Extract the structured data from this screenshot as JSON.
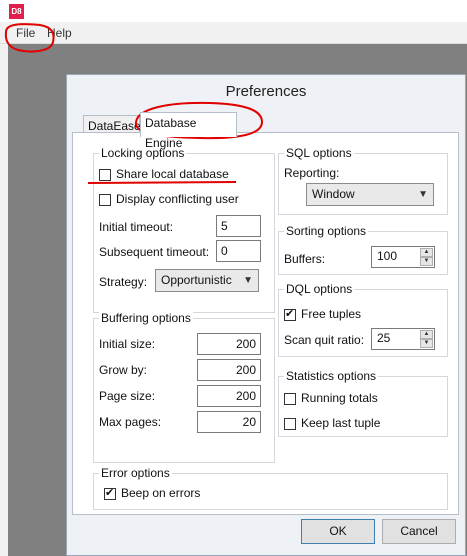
{
  "app": {
    "icon_text": "D8"
  },
  "menu": {
    "file": "File",
    "help": "Help"
  },
  "dialog": {
    "title": "Preferences",
    "tabs": [
      "DataEase",
      "Database Engine"
    ],
    "locking": {
      "title": "Locking options",
      "share_local_db": {
        "label": "Share local database",
        "checked": false
      },
      "display_conflicting": {
        "label": "Display conflicting user",
        "checked": false
      },
      "initial_timeout": {
        "label": "Initial timeout:",
        "value": "5"
      },
      "subsequent_timeout": {
        "label": "Subsequent timeout:",
        "value": "0"
      },
      "strategy": {
        "label": "Strategy:",
        "value": "Opportunistic"
      }
    },
    "buffering": {
      "title": "Buffering options",
      "initial_size": {
        "label": "Initial size:",
        "value": "200"
      },
      "grow_by": {
        "label": "Grow by:",
        "value": "200"
      },
      "page_size": {
        "label": "Page size:",
        "value": "200"
      },
      "max_pages": {
        "label": "Max pages:",
        "value": "20"
      }
    },
    "error": {
      "title": "Error options",
      "beep": {
        "label": "Beep on errors",
        "checked": true
      }
    },
    "sql": {
      "title": "SQL options",
      "reporting_label": "Reporting:",
      "reporting_value": "Window"
    },
    "sorting": {
      "title": "Sorting options",
      "buffers": {
        "label": "Buffers:",
        "value": "100"
      }
    },
    "dql": {
      "title": "DQL options",
      "free_tuples": {
        "label": "Free tuples",
        "checked": true
      },
      "scan_quit_ratio": {
        "label": "Scan quit ratio:",
        "value": "25"
      }
    },
    "statistics": {
      "title": "Statistics options",
      "running_totals": {
        "label": "Running totals",
        "checked": false
      },
      "keep_last_tuple": {
        "label": "Keep last tuple",
        "checked": false
      }
    },
    "buttons": {
      "ok": "OK",
      "cancel": "Cancel"
    }
  },
  "colors": {
    "accent": "#e0204c",
    "annotation": "#e00000"
  }
}
